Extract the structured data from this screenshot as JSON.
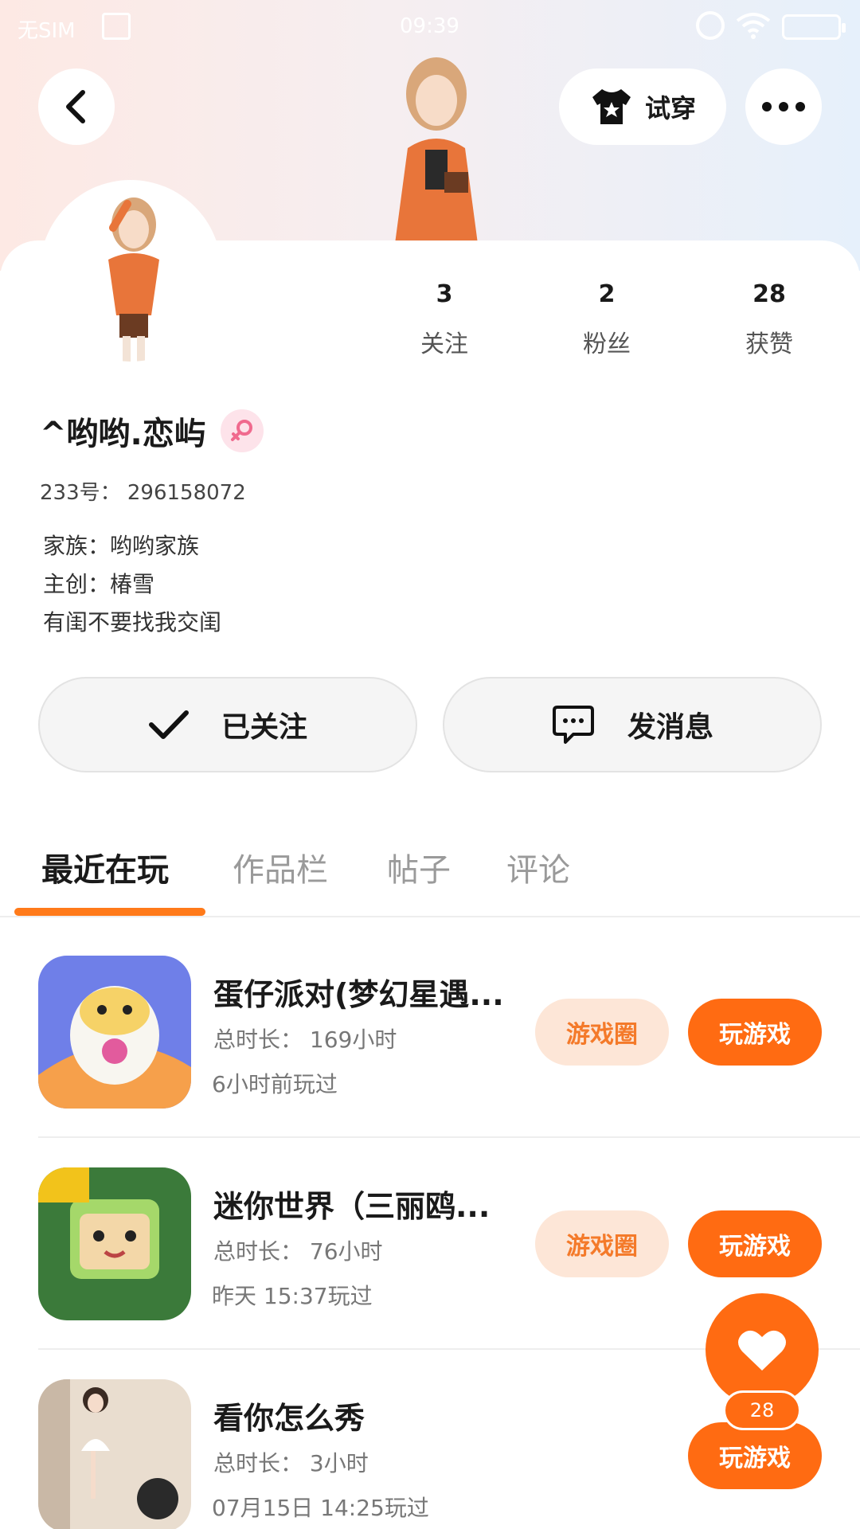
{
  "status_bar": {
    "sim": "无SIM",
    "time": "09:39"
  },
  "header": {
    "try_on_label": "试穿"
  },
  "profile": {
    "stats": [
      {
        "num": "3",
        "label": "关注"
      },
      {
        "num": "2",
        "label": "粉丝"
      },
      {
        "num": "28",
        "label": "获赞"
      }
    ],
    "nickname": "^哟哟.恋屿",
    "uid": "233号： 296158072",
    "bio": [
      "家族：哟哟家族",
      "主创：椿雪",
      "有闺不要找我交闺"
    ]
  },
  "actions": {
    "follow_label": "已关注",
    "message_label": "发消息"
  },
  "tabs": [
    "最近在玩",
    "作品栏",
    "帖子",
    "评论"
  ],
  "games": [
    {
      "title": "蛋仔派对(梦幻星遇...",
      "duration": "总时长： 169小时",
      "last_played": "6小时前玩过",
      "circle_label": "游戏圈",
      "play_label": "玩游戏"
    },
    {
      "title": "迷你世界（三丽鸥...",
      "duration": "总时长： 76小时",
      "last_played": "昨天 15:37玩过",
      "circle_label": "游戏圈",
      "play_label": "玩游戏"
    },
    {
      "title": "看你怎么秀",
      "duration": "总时长： 3小时",
      "last_played": "07月15日 14:25玩过",
      "play_label": "玩游戏"
    }
  ],
  "like": {
    "count": "28"
  },
  "colors": {
    "accent": "#ff6b12",
    "accent_light": "#fde6d7"
  }
}
